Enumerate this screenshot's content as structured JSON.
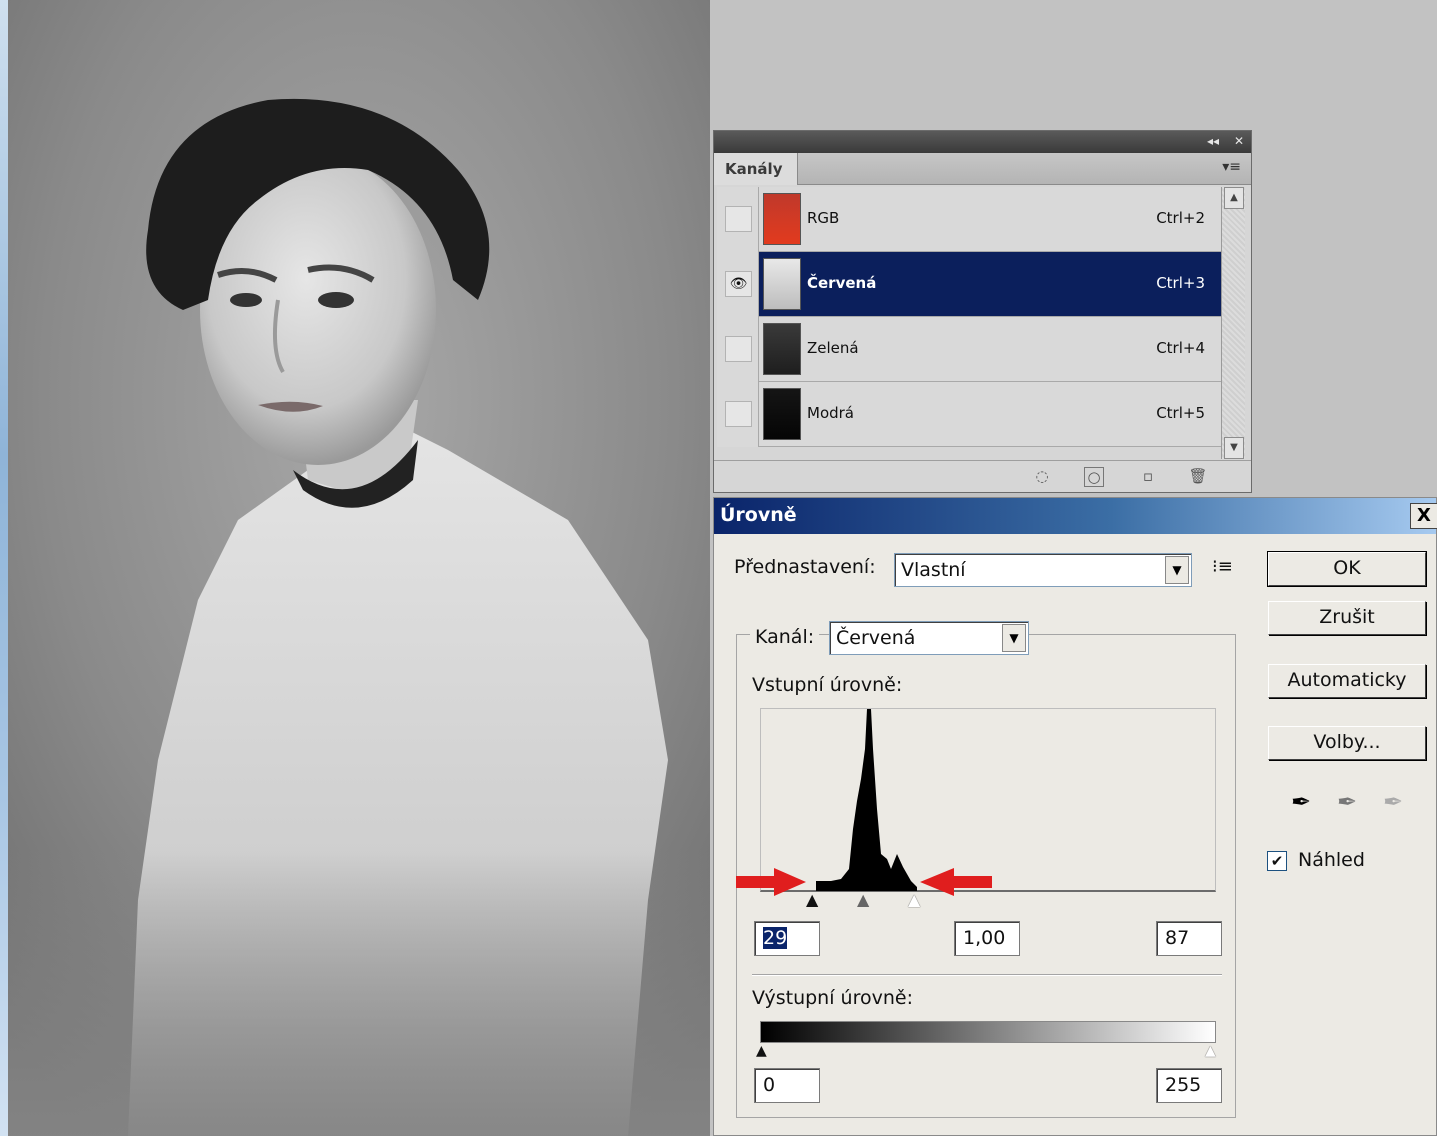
{
  "channels_panel": {
    "collapse_icon": "◂◂",
    "close_icon": "✕",
    "tab_label": "Kanály",
    "menu_icon": "▾≡",
    "rows": [
      {
        "name": "RGB",
        "shortcut": "Ctrl+2",
        "visible": false,
        "selected": false,
        "eye": ""
      },
      {
        "name": "Červená",
        "shortcut": "Ctrl+3",
        "visible": true,
        "selected": true,
        "eye": "👁"
      },
      {
        "name": "Zelená",
        "shortcut": "Ctrl+4",
        "visible": false,
        "selected": false,
        "eye": ""
      },
      {
        "name": "Modrá",
        "shortcut": "Ctrl+5",
        "visible": false,
        "selected": false,
        "eye": ""
      }
    ],
    "bottom_icons": [
      "dotted-circle-icon",
      "mask-icon",
      "new-channel-icon",
      "trash-icon"
    ]
  },
  "levels_dialog": {
    "title": "Úrovně",
    "close_label": "X",
    "preset_label": "Přednastavení:",
    "preset_value": "Vlastní",
    "channel_label": "Kanál:",
    "channel_value": "Červená",
    "input_levels_label": "Vstupní úrovně:",
    "input_black": "29",
    "input_gamma": "1,00",
    "input_white": "87",
    "output_levels_label": "Výstupní úrovně:",
    "output_black": "0",
    "output_white": "255",
    "buttons": {
      "ok": "OK",
      "cancel": "Zrušit",
      "auto": "Automaticky",
      "options": "Volby..."
    },
    "preview_label": "Náhled",
    "preview_checked": true,
    "check_mark": "✔",
    "dropdown_arrow": "▼"
  },
  "colors": {
    "selection": "#0b1f5c",
    "arrow_red": "#e01e1e",
    "dialog_title_start": "#0a246a",
    "dialog_title_end": "#a6caf0"
  }
}
